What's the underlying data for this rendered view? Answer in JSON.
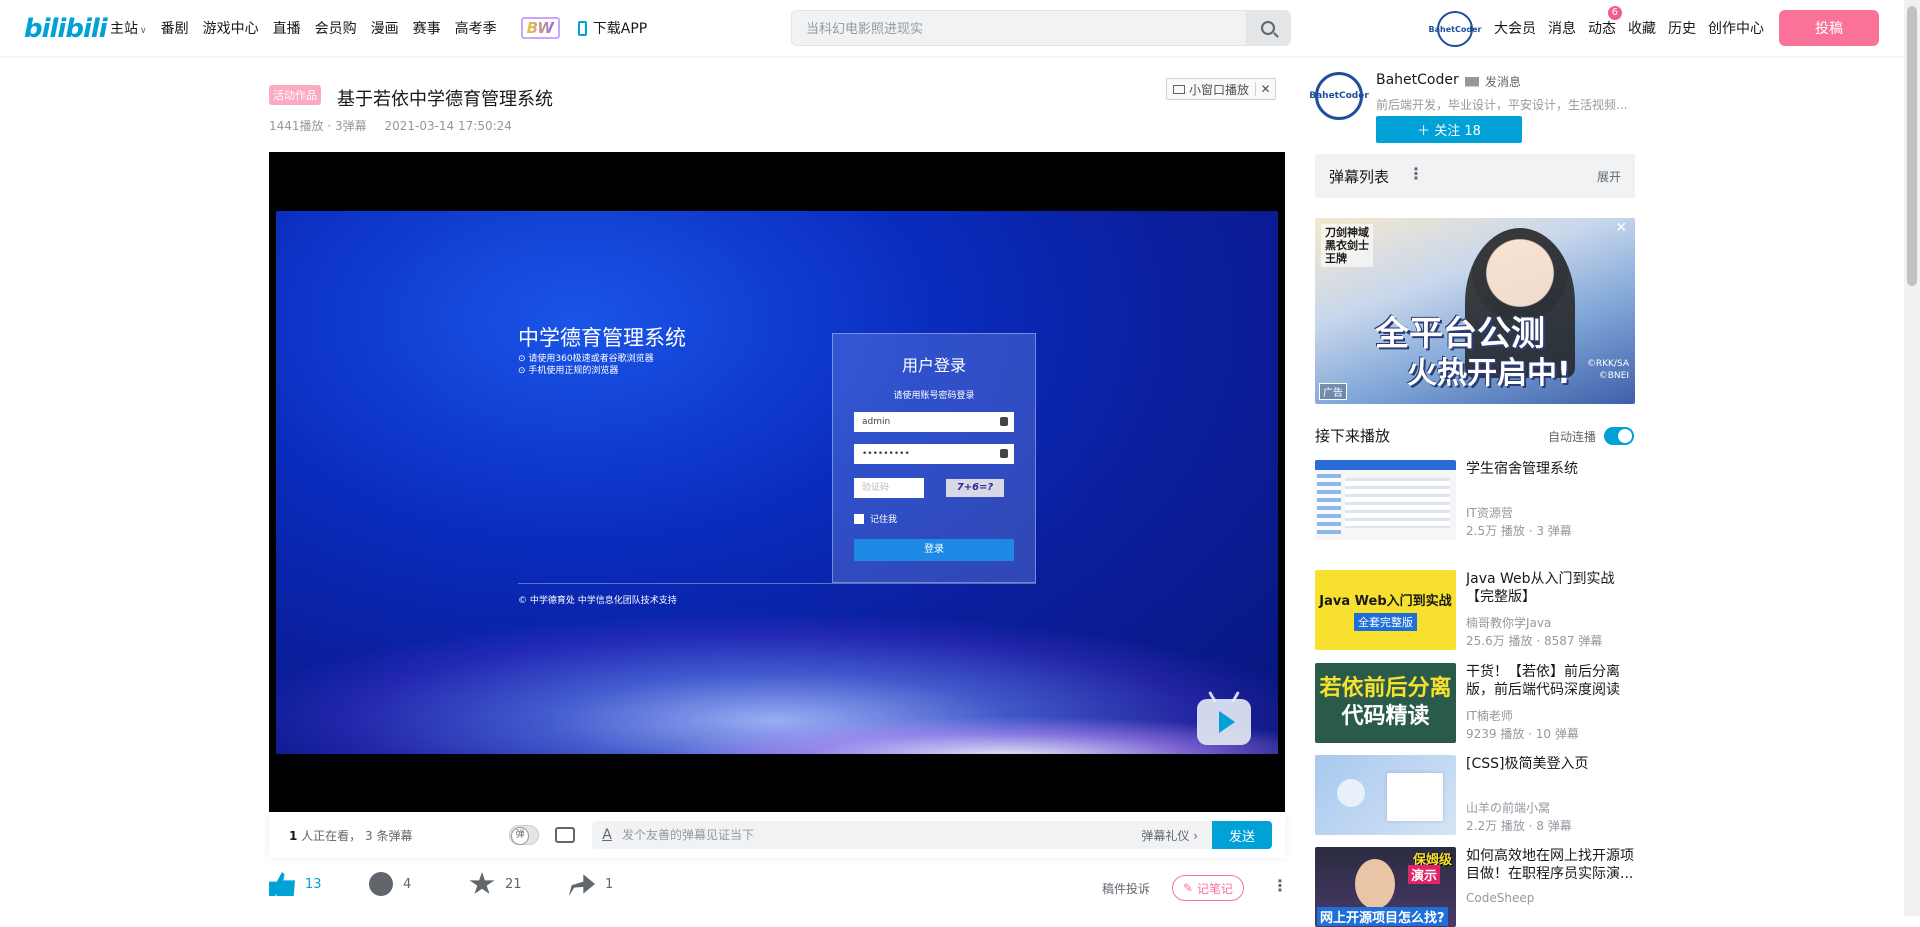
{
  "header": {
    "logo": "bilibili",
    "nav": [
      "主站",
      "番剧",
      "游戏中心",
      "直播",
      "会员购",
      "漫画",
      "赛事",
      "高考季"
    ],
    "bw": "BW",
    "download_app": "下载APP",
    "search_placeholder": "当科幻电影照进现实",
    "avatar_text": "BahetCoder",
    "links": [
      "大会员",
      "消息",
      "动态",
      "收藏",
      "历史",
      "创作中心"
    ],
    "dynamic_badge": "6",
    "upload": "投稿"
  },
  "video": {
    "tag": "活动作品",
    "title": "基于若依中学德育管理系统",
    "plays": "1441播放 · 3弹幕",
    "date": "2021-03-14 17:50:24",
    "mini_player": "小窗口播放"
  },
  "screen": {
    "sys_title": "中学德育管理系统",
    "tip1": "⊙ 请使用360极速或者谷歌浏览器",
    "tip2": "⊙ 手机使用正规的浏览器",
    "footer": "© 中学德育处    中学信息化团队技术支持",
    "login_title": "用户登录",
    "login_sub": "请使用账号密码登录",
    "username": "admin",
    "password": "•••••••••",
    "captcha_placeholder": "验证码",
    "captcha_img": "7+6=?",
    "remember": "记住我",
    "login_btn": "登录"
  },
  "sendbar": {
    "viewers_count": "1",
    "viewers_text": " 人正在看， 3 条弹幕",
    "placeholder": "发个友善的弹幕见证当下",
    "etiquette": "弹幕礼仪 ›",
    "send": "发送"
  },
  "toolbar": {
    "likes": "13",
    "coins": "4",
    "favs": "21",
    "shares": "1",
    "report": "稿件投诉",
    "note": "记笔记",
    "more": "⋮"
  },
  "up": {
    "name": "BahetCoder",
    "message": "发消息",
    "desc": "前后端开发，毕业设计，平安设计，生活视频...",
    "follow": "＋  关注 18",
    "avatar_text": "BahetCoder"
  },
  "danmaku_list": {
    "title": "弹幕列表",
    "dots": "⋮",
    "expand": "展开"
  },
  "ad": {
    "corner1": "刀剑神域",
    "corner2": "黑衣剑士",
    "corner3": "王牌",
    "headline": "全平台公测",
    "sub": "火热开启中!",
    "copy": "©RKK/SA\n©BNEI",
    "tag": "广告",
    "close": "✕"
  },
  "next": {
    "title": "接下来播放",
    "autoplay": "自动连播"
  },
  "recs": [
    {
      "title": "学生宿舍管理系统",
      "author": "IT资源营",
      "stats": "2.5万 播放 · 3 弹幕"
    },
    {
      "title": "Java Web从入门到实战【完整版】",
      "author": "楠哥教你学Java",
      "stats": "25.6万 播放 · 8587 弹幕",
      "thumb_a": "Java Web入门到实战",
      "thumb_b": "全套完整版"
    },
    {
      "title": "干货！【若依】前后分离版，前后端代码深度阅读",
      "author": "IT楠老师",
      "stats": "9239 播放 · 10 弹幕",
      "thumb_a": "若依前后分离",
      "thumb_b": "代码精读"
    },
    {
      "title": "[CSS]极简美登入页",
      "author": "山羊の前端小窝",
      "stats": "2.2万 播放 · 8 弹幕"
    },
    {
      "title": "如何高效地在网上找开源项目做！在职程序员实际演...",
      "author": "CodeSheep",
      "stats": "",
      "thumb_a": "保姆级",
      "thumb_b": "演示",
      "thumb_c": "网上开源项目怎么找?"
    }
  ]
}
